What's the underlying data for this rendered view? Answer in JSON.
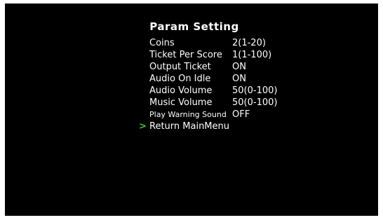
{
  "title": "Param Setting",
  "cursor_symbol": ">",
  "cursor_color": "#3ec63e",
  "items": [
    {
      "label": "Coins",
      "value": "2(1-20)"
    },
    {
      "label": "Ticket Per Score",
      "value": "1(1-100)"
    },
    {
      "label": "Output Ticket",
      "value": "ON"
    },
    {
      "label": "Audio On Idle",
      "value": "ON"
    },
    {
      "label": "Audio Volume",
      "value": "50(0-100)"
    },
    {
      "label": "Music Volume",
      "value": "50(0-100)"
    },
    {
      "label": "Play Warning Sound",
      "value": "OFF"
    },
    {
      "label": "Return MainMenu",
      "value": ""
    }
  ],
  "selected_index": 7
}
